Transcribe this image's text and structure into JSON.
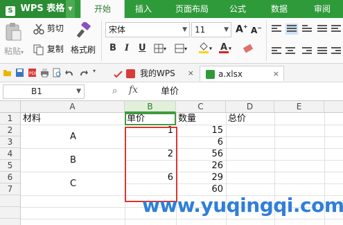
{
  "app": {
    "name": "WPS 表格",
    "menu_tabs": [
      "开始",
      "插入",
      "页面布局",
      "公式",
      "数据",
      "审阅"
    ],
    "active_tab": "开始"
  },
  "ribbon": {
    "paste": "粘贴",
    "cut": "剪切",
    "copy": "复制",
    "format_painter": "格式刷",
    "font_name": "宋体",
    "font_size": "11",
    "bold": "B",
    "italic": "I",
    "underline": "U"
  },
  "colors": {
    "accent_green": "#2f9a3a",
    "highlight_red": "#e03131",
    "watermark_blue": "#2f7fd8"
  },
  "doc_tabs": [
    {
      "label": "我的WPS"
    },
    {
      "label": "a.xlsx"
    }
  ],
  "formula_bar": {
    "cell_ref": "B1",
    "fx": "fx",
    "value": "单价"
  },
  "sheet": {
    "columns": [
      "A",
      "B",
      "C",
      "D",
      "E"
    ],
    "rows": [
      "1",
      "2",
      "3",
      "4",
      "5",
      "6",
      "7"
    ],
    "header": {
      "a": "材料",
      "b": "单价",
      "c": "数量",
      "d": "总价"
    },
    "groups": [
      {
        "material": "A",
        "price": "1",
        "qty": [
          "15",
          "6"
        ]
      },
      {
        "material": "B",
        "price": "2",
        "qty": [
          "56",
          "26"
        ]
      },
      {
        "material": "C",
        "price": "6",
        "qty": [
          "29",
          "60"
        ]
      }
    ]
  },
  "watermark": "www.yuqingqi.com"
}
